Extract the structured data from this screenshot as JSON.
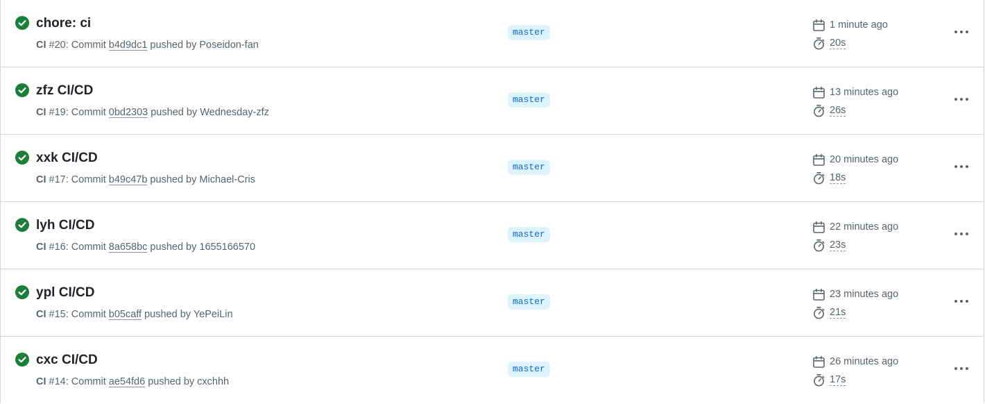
{
  "colors": {
    "success": "#1a7f37",
    "branch_bg": "#ddf4ff",
    "branch_text": "#0969da",
    "muted_text": "#59636e",
    "border": "#d1d9e0"
  },
  "icons": {
    "status": "check-circle-fill-icon",
    "date": "calendar-icon",
    "duration": "stopwatch-icon",
    "more": "kebab-horizontal-icon"
  },
  "runs": [
    {
      "title": "chore: ci",
      "workflow": "CI",
      "run_number": "#20",
      "commit_prefix": ": Commit ",
      "sha": "b4d9dc1",
      "pushed_text": " pushed by ",
      "actor": "Poseidon-fan",
      "branch": "master",
      "time_ago": "1 minute ago",
      "duration": "20s"
    },
    {
      "title": "zfz CI/CD",
      "workflow": "CI",
      "run_number": "#19",
      "commit_prefix": ": Commit ",
      "sha": "0bd2303",
      "pushed_text": " pushed by ",
      "actor": "Wednesday-zfz",
      "branch": "master",
      "time_ago": "13 minutes ago",
      "duration": "26s"
    },
    {
      "title": "xxk CI/CD",
      "workflow": "CI",
      "run_number": "#17",
      "commit_prefix": ": Commit ",
      "sha": "b49c47b",
      "pushed_text": " pushed by ",
      "actor": "Michael-Cris",
      "branch": "master",
      "time_ago": "20 minutes ago",
      "duration": "18s"
    },
    {
      "title": "lyh CI/CD",
      "workflow": "CI",
      "run_number": "#16",
      "commit_prefix": ": Commit ",
      "sha": "8a658bc",
      "pushed_text": " pushed by ",
      "actor": "1655166570",
      "branch": "master",
      "time_ago": "22 minutes ago",
      "duration": "23s"
    },
    {
      "title": "ypl CI/CD",
      "workflow": "CI",
      "run_number": "#15",
      "commit_prefix": ": Commit ",
      "sha": "b05caff",
      "pushed_text": " pushed by ",
      "actor": "YePeiLin",
      "branch": "master",
      "time_ago": "23 minutes ago",
      "duration": "21s"
    },
    {
      "title": "cxc CI/CD",
      "workflow": "CI",
      "run_number": "#14",
      "commit_prefix": ": Commit ",
      "sha": "ae54fd6",
      "pushed_text": " pushed by ",
      "actor": "cxchhh",
      "branch": "master",
      "time_ago": "26 minutes ago",
      "duration": "17s"
    }
  ]
}
